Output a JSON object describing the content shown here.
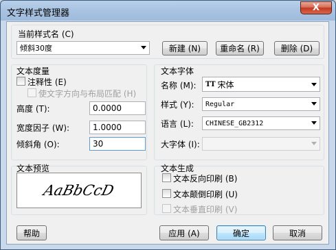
{
  "window": {
    "title": "文字样式管理器",
    "close_label": "X"
  },
  "current_style": {
    "group_label": "当前样式名 (C)",
    "value": "倾斜30度",
    "buttons": {
      "new": "新建 (N)",
      "rename": "重命名 (R)",
      "delete": "删除 (D)"
    }
  },
  "metrics": {
    "group_label": "文本度量",
    "annotative_label": "注释性 (E)",
    "match_layout_label": "使文字方向与布局匹配 (H)",
    "height_label": "高度 (T):",
    "height_value": "0.0000",
    "width_factor_label": "宽度因子 (W):",
    "width_factor_value": "1.0000",
    "oblique_label": "倾斜角 (O):",
    "oblique_value": "30"
  },
  "font": {
    "group_label": "文本字体",
    "name_label": "名称 (M):",
    "name_value": "宋体",
    "style_label": "样式 (Y):",
    "style_value": "Regular",
    "language_label": "语言 (L):",
    "language_value": "CHINESE_GB2312",
    "bigfont_label": "大字体 (I):",
    "bigfont_value": ""
  },
  "preview": {
    "group_label": "文本预览",
    "sample": "AaBbCcD"
  },
  "generation": {
    "group_label": "文本生成",
    "backwards_label": "文本反向印刷 (B)",
    "upside_down_label": "文本颠倒印刷 (U)",
    "vertical_label": "文本垂直印刷 (V)"
  },
  "footer": {
    "help": "帮助",
    "apply": "应用 (A)",
    "ok": "确定",
    "cancel": "取消"
  }
}
